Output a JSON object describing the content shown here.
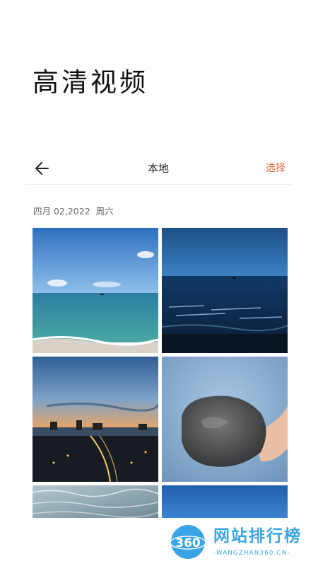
{
  "page": {
    "title": "高清视频"
  },
  "header": {
    "back_icon": "arrow-left-icon",
    "title": "本地",
    "select_label": "选择",
    "select_color": "#e0663b"
  },
  "gallery": {
    "groups": [
      {
        "date": "四月 02,2022  周六",
        "photos": [
          {
            "subject": "sea-horizon-daytime"
          },
          {
            "subject": "dark-blue-sea"
          },
          {
            "subject": "coastal-city-dusk"
          },
          {
            "subject": "stone-in-hand"
          },
          {
            "subject": "sparkling-water"
          },
          {
            "subject": "blue-sky"
          }
        ]
      }
    ]
  },
  "watermark": {
    "logo_text": "360",
    "title": "网站排行榜",
    "subtitle": "-WANGZHAN360.CN-",
    "color": "#2a9de4"
  }
}
